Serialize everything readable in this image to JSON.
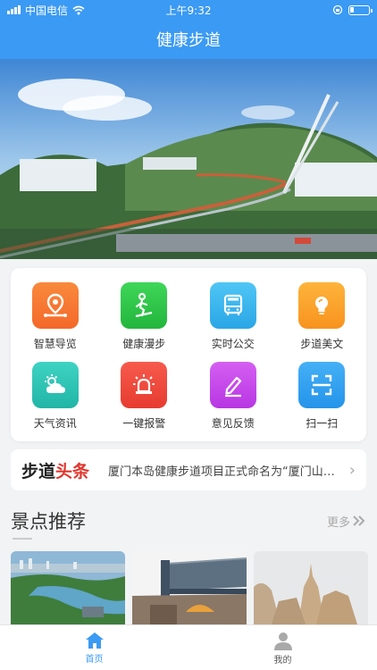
{
  "status_bar": {
    "carrier": "中国电信",
    "time": "上午9:32"
  },
  "nav": {
    "title": "健康步道"
  },
  "features": [
    {
      "label": "智慧导览",
      "icon": "location-route-icon",
      "color": "#f7772f"
    },
    {
      "label": "健康漫步",
      "icon": "walking-icon",
      "color": "#2fc84a"
    },
    {
      "label": "实时公交",
      "icon": "bus-icon",
      "color": "#3fb8ef"
    },
    {
      "label": "步道美文",
      "icon": "lightbulb-icon",
      "color": "#fba22a"
    },
    {
      "label": "天气资讯",
      "icon": "weather-icon",
      "color": "#2bc4b6"
    },
    {
      "label": "一键报警",
      "icon": "alarm-icon",
      "color": "#f04a3e"
    },
    {
      "label": "意见反馈",
      "icon": "feedback-pen-icon",
      "color": "#c948ea"
    },
    {
      "label": "扫一扫",
      "icon": "scan-icon",
      "color": "#2fa0f0"
    }
  ],
  "news": {
    "brand_black": "步道",
    "brand_red": "头条",
    "headline": "厦门本岛健康步道项目正式命名为“厦门山海健康步道”"
  },
  "scenic": {
    "title": "景点推荐",
    "more": "更多"
  },
  "tabs": [
    {
      "label": "首页",
      "icon": "home-icon"
    },
    {
      "label": "我的",
      "icon": "user-icon"
    }
  ],
  "colors": {
    "primary": "#3b9af3",
    "accent_red": "#e0362d"
  }
}
